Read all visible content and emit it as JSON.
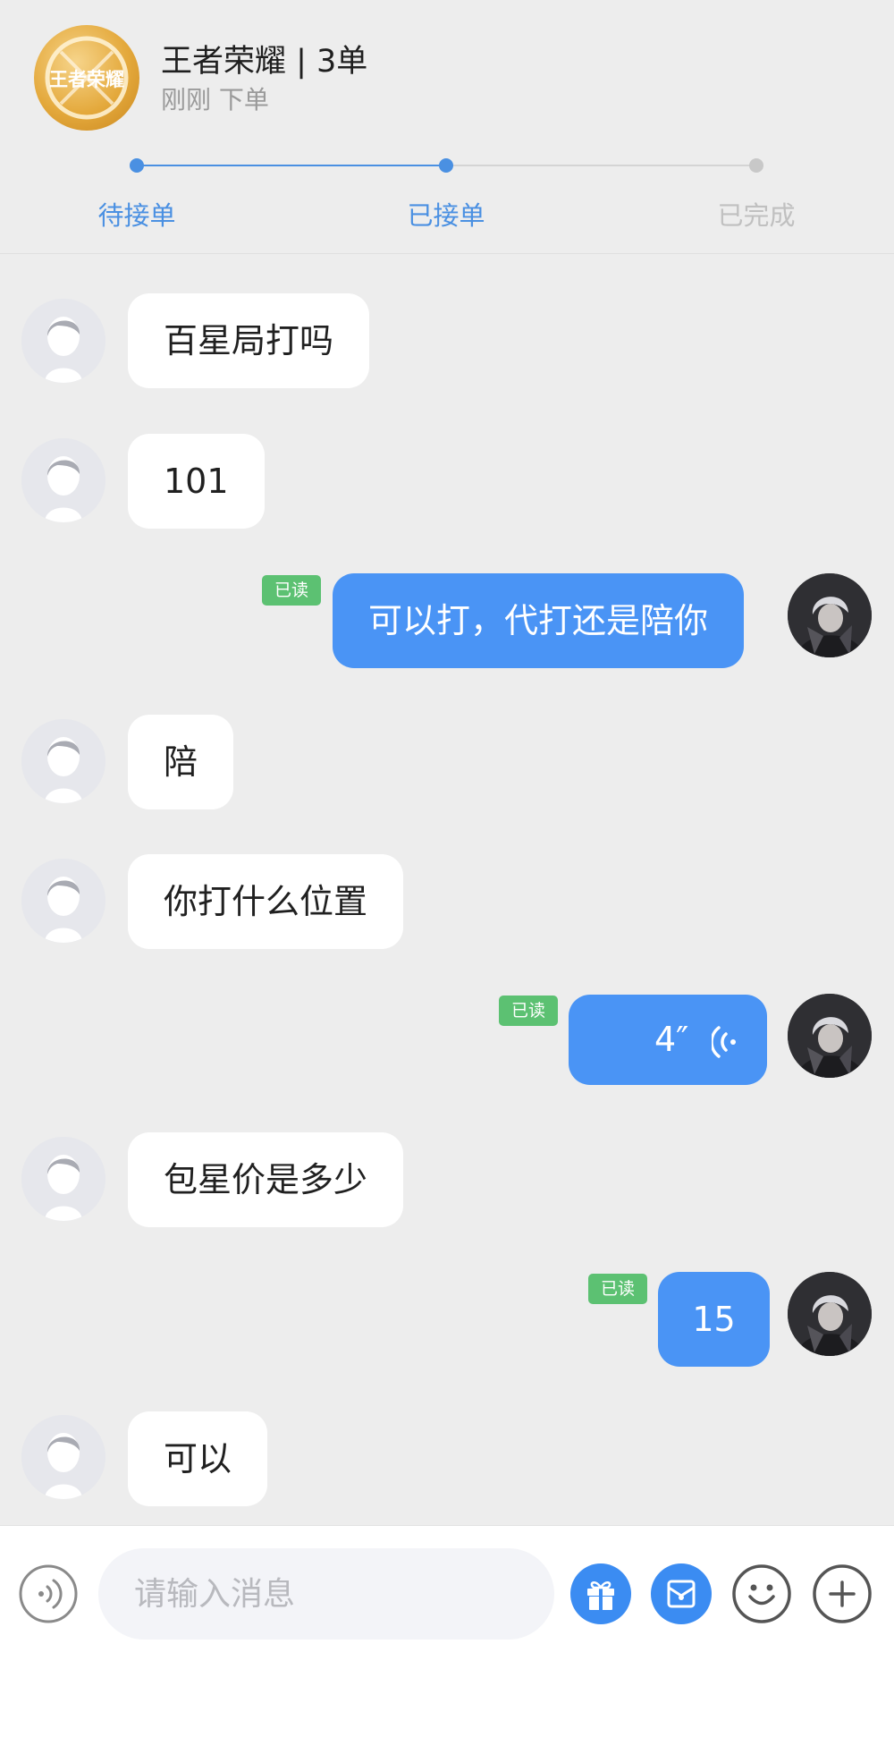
{
  "header": {
    "logo_text": "王者荣耀",
    "title": "王者荣耀 | 3单",
    "subtitle": "刚刚 下单",
    "steps": [
      {
        "label": "待接单",
        "state": "done"
      },
      {
        "label": "已接单",
        "state": "done"
      },
      {
        "label": "已完成",
        "state": "pending"
      }
    ],
    "colors": {
      "active": "#4a90e2",
      "inactive": "#c8c8c8"
    }
  },
  "messages": [
    {
      "side": "in",
      "text": "百星局打吗"
    },
    {
      "side": "in",
      "text": "101"
    },
    {
      "side": "out",
      "text": "可以打，代打还是陪你",
      "read": "已读"
    },
    {
      "side": "in",
      "text": "陪"
    },
    {
      "side": "in",
      "text": "你打什么位置"
    },
    {
      "side": "out",
      "type": "voice",
      "text": "4″",
      "read": "已读"
    },
    {
      "side": "in",
      "text": "包星价是多少"
    },
    {
      "side": "out",
      "text": "15",
      "read": "已读"
    },
    {
      "side": "in",
      "text": "可以"
    }
  ],
  "input_bar": {
    "placeholder": "请输入消息",
    "buttons": [
      "voice-toggle-icon",
      "gift-icon",
      "red-packet-icon",
      "emoji-icon",
      "plus-icon"
    ]
  },
  "colors": {
    "bubble_out": "#4a94f5",
    "read_badge": "#5cc172",
    "background": "#ededed"
  }
}
